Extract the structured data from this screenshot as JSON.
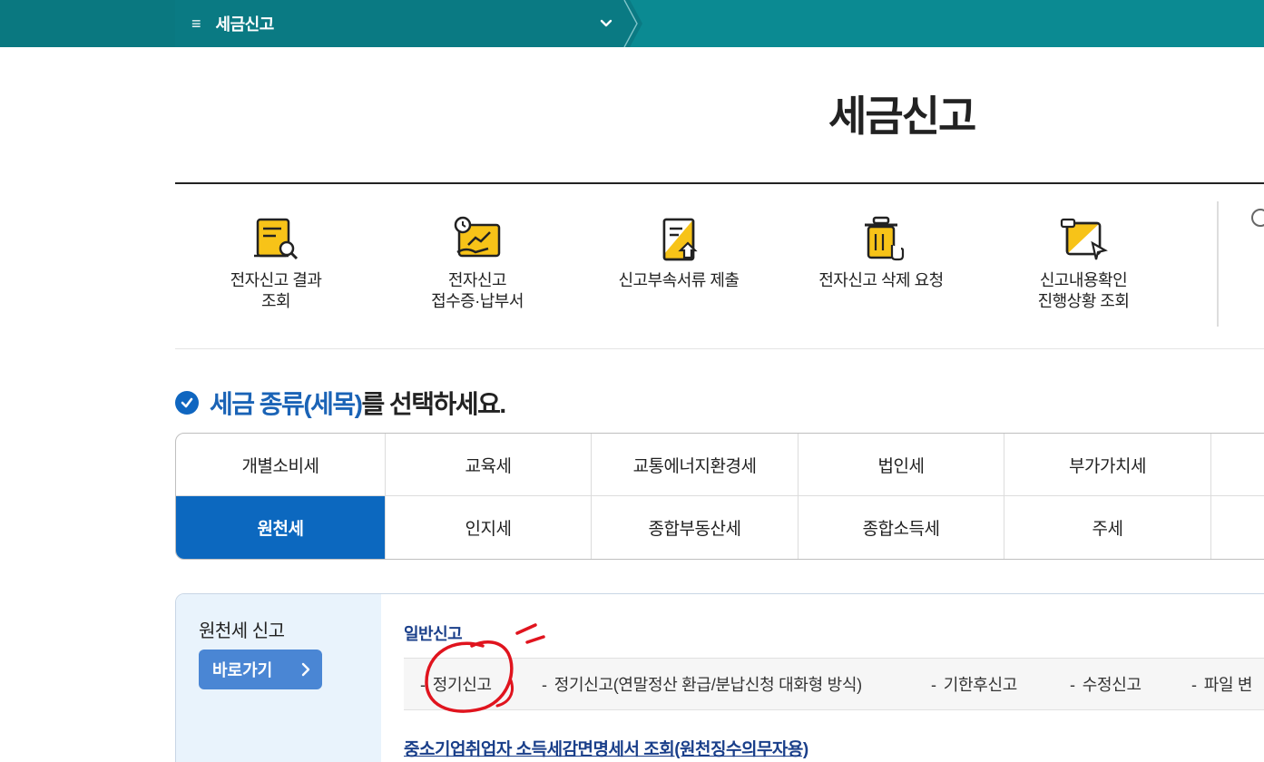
{
  "breadcrumb": {
    "menu_icon": "≡",
    "label": "세금신고",
    "dropdown_icon": "chevron-down-icon"
  },
  "page_title": "세금신고",
  "quick_menu": [
    {
      "line1": "전자신고 결과",
      "line2": "조회",
      "icon": "document-search-icon"
    },
    {
      "line1": "전자신고",
      "line2": "접수증·납부서",
      "icon": "receipt-clock-icon"
    },
    {
      "line1": "신고부속서류 제출",
      "line2": "",
      "icon": "document-upload-icon"
    },
    {
      "line1": "전자신고 삭제 요청",
      "line2": "",
      "icon": "trash-icon"
    },
    {
      "line1": "신고내용확인",
      "line2": "진행상황 조회",
      "icon": "status-check-icon"
    }
  ],
  "section_heading": {
    "highlight": "세금 종류(세목)",
    "rest": "를 선택하세요."
  },
  "tax_types": {
    "row1": [
      "개별소비세",
      "교육세",
      "교통에너지환경세",
      "법인세",
      "부가가치세",
      ""
    ],
    "row2": [
      "원천세",
      "인지세",
      "종합부동산세",
      "종합소득세",
      "주세",
      ""
    ],
    "selected": "원천세"
  },
  "panel": {
    "side_title": "원천세 신고",
    "go_button": "바로가기",
    "category_title": "일반신고",
    "links": [
      "정기신고",
      "정기신고(연말정산 환급/분납신청 대화형 방식)",
      "기한후신고",
      "수정신고",
      "파일 변"
    ],
    "link_dash": "-",
    "sub_link": "중소기업취업자 소득세감면명세서 조회(원천징수의무자용)"
  },
  "colors": {
    "topbar": "#0b8a92",
    "accent": "#0c68bf",
    "annotation": "#e0141e"
  }
}
